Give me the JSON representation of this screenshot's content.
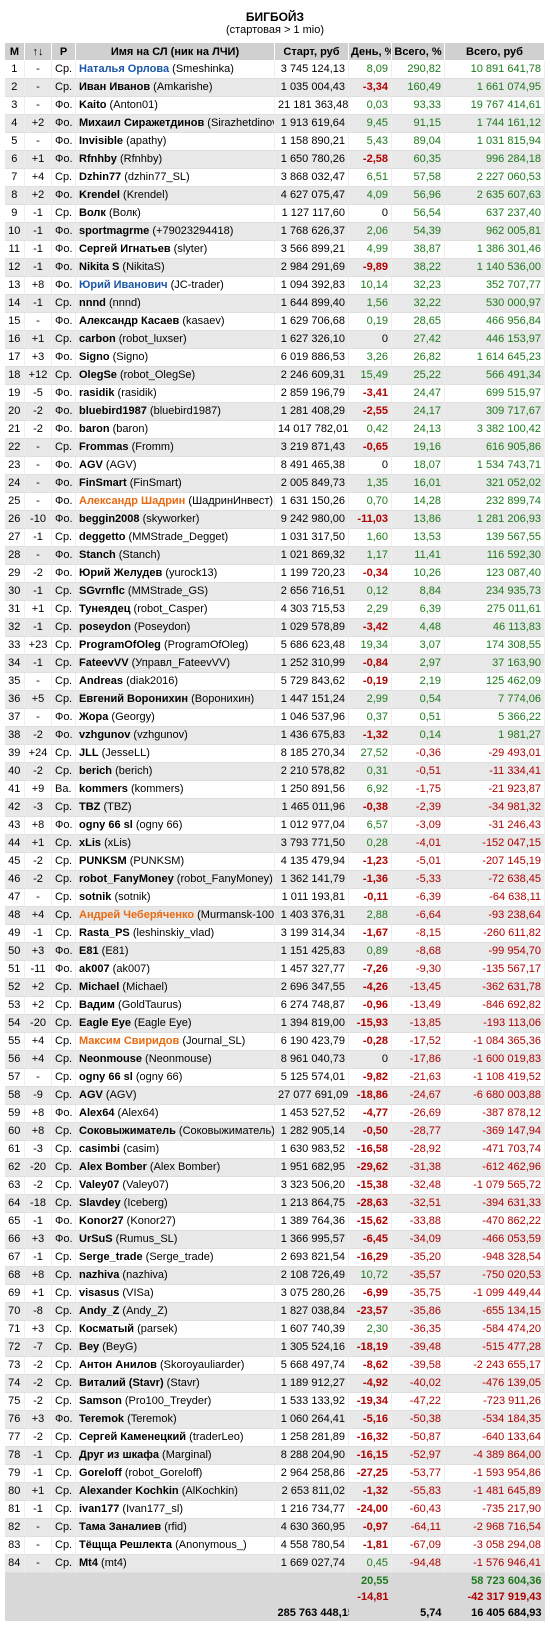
{
  "title": "БИГБОЙЗ",
  "subtitle": "(стартовая > 1 mio)",
  "columns": [
    "М",
    "↑↓",
    "Р",
    "Имя на СЛ (ник на ЛЧИ)",
    "Старт, руб",
    "День, %",
    "Всего, %",
    "Всего, руб"
  ],
  "rows": [
    [
      "1",
      "-",
      "Ср.",
      "Наталья Орлова",
      "Smeshinka",
      "3 745 124,13",
      "8,09",
      "290,82",
      "10 891 641,78"
    ],
    [
      "2",
      "-",
      "Ср.",
      "Иван Иванов",
      "Amkarishe",
      "1 035 004,43",
      "-3,34",
      "160,49",
      "1 661 074,95"
    ],
    [
      "3",
      "-",
      "Фо.",
      "Kaito",
      "Anton01",
      "21 181 363,48",
      "0,03",
      "93,33",
      "19 767 414,61"
    ],
    [
      "4",
      "+2",
      "Фо.",
      "Михаил Сиражетдинов",
      "Sirazhetdinov",
      "1 913 619,64",
      "9,45",
      "91,15",
      "1 744 161,12"
    ],
    [
      "5",
      "-",
      "Фо.",
      "Invisible",
      "apathy",
      "1 158 890,21",
      "5,43",
      "89,04",
      "1 031 815,94"
    ],
    [
      "6",
      "+1",
      "Фо.",
      "Rfnhby",
      "Rfnhby",
      "1 650 780,26",
      "-2,58",
      "60,35",
      "996 284,18"
    ],
    [
      "7",
      "+4",
      "Ср.",
      "Dzhin77",
      "dzhin77_SL",
      "3 868 032,47",
      "6,51",
      "57,58",
      "2 227 060,53"
    ],
    [
      "8",
      "+2",
      "Фо.",
      "Krendel",
      "Krendel",
      "4 627 075,47",
      "4,09",
      "56,96",
      "2 635 607,63"
    ],
    [
      "9",
      "-1",
      "Ср.",
      "Волк",
      "Волк",
      "1 127 117,60",
      "0",
      "56,54",
      "637 237,40"
    ],
    [
      "10",
      "-1",
      "Фо.",
      "sportmagrme",
      "+79023294418",
      "1 768 626,37",
      "2,06",
      "54,39",
      "962 005,81"
    ],
    [
      "11",
      "-1",
      "Фо.",
      "Сергей Игнатьев",
      "slyter",
      "3 566 899,21",
      "4,99",
      "38,87",
      "1 386 301,46"
    ],
    [
      "12",
      "-1",
      "Фо.",
      "Nikita S",
      "NikitaS",
      "2 984 291,69",
      "-9,89",
      "38,22",
      "1 140 536,00"
    ],
    [
      "13",
      "+8",
      "Фо.",
      "Юрий Иванович",
      "JC-trader",
      "1 094 392,83",
      "10,14",
      "32,23",
      "352 707,77"
    ],
    [
      "14",
      "-1",
      "Ср.",
      "nnnd",
      "nnnd",
      "1 644 899,40",
      "1,56",
      "32,22",
      "530 000,97"
    ],
    [
      "15",
      "-",
      "Фо.",
      "Александр Касаев",
      "kasaev",
      "1 629 706,68",
      "0,19",
      "28,65",
      "466 956,84"
    ],
    [
      "16",
      "+1",
      "Ср.",
      "carbon",
      "robot_luxser",
      "1 627 326,10",
      "0",
      "27,42",
      "446 153,97"
    ],
    [
      "17",
      "+3",
      "Фо.",
      "Signo",
      "Signo",
      "6 019 886,53",
      "3,26",
      "26,82",
      "1 614 645,23"
    ],
    [
      "18",
      "+12",
      "Ср.",
      "OlegSe",
      "robot_OlegSe",
      "2 246 609,31",
      "15,49",
      "25,22",
      "566 491,34"
    ],
    [
      "19",
      "-5",
      "Фо.",
      "rasidik",
      "rasidik",
      "2 859 196,79",
      "-3,41",
      "24,47",
      "699 515,97"
    ],
    [
      "20",
      "-2",
      "Фо.",
      "bluebird1987",
      "bluebird1987",
      "1 281 408,29",
      "-2,55",
      "24,17",
      "309 717,67"
    ],
    [
      "21",
      "-2",
      "Фо.",
      "baron",
      "baron",
      "14 017 782,01",
      "0,42",
      "24,13",
      "3 382 100,42"
    ],
    [
      "22",
      "-",
      "Ср.",
      "Frommas",
      "Fromm",
      "3 219 871,43",
      "-0,65",
      "19,16",
      "616 905,86"
    ],
    [
      "23",
      "-",
      "Фо.",
      "AGV",
      "AGV",
      "8 491 465,38",
      "0",
      "18,07",
      "1 534 743,71"
    ],
    [
      "24",
      "-",
      "Фо.",
      "FinSmart",
      "FinSmart",
      "2 005 849,73",
      "1,35",
      "16,01",
      "321 052,02"
    ],
    [
      "25",
      "-",
      "Фо.",
      "Александр Шадрин",
      "ШадринИнвест",
      "1 631 150,26",
      "0,70",
      "14,28",
      "232 899,74"
    ],
    [
      "26",
      "-10",
      "Фо.",
      "beggin2008",
      "skyworker",
      "9 242 980,00",
      "-11,03",
      "13,86",
      "1 281 206,93"
    ],
    [
      "27",
      "-1",
      "Ср.",
      "deggetto",
      "MMStrade_Degget",
      "1 031 317,50",
      "1,60",
      "13,53",
      "139 567,55"
    ],
    [
      "28",
      "-",
      "Фо.",
      "Stanch",
      "Stanch",
      "1 021 869,32",
      "1,17",
      "11,41",
      "116 592,30"
    ],
    [
      "29",
      "-2",
      "Фо.",
      "Юрий Желудев",
      "yurock13",
      "1 199 720,23",
      "-0,34",
      "10,26",
      "123 087,40"
    ],
    [
      "30",
      "-1",
      "Ср.",
      "SGvrnflc",
      "MMStrade_GS",
      "2 656 716,51",
      "0,12",
      "8,84",
      "234 935,73"
    ],
    [
      "31",
      "+1",
      "Ср.",
      "Тунеядец",
      "robot_Casper",
      "4 303 715,53",
      "2,29",
      "6,39",
      "275 011,61"
    ],
    [
      "32",
      "-1",
      "Ср.",
      "poseydon",
      "Poseydon",
      "1 029 578,89",
      "-3,42",
      "4,48",
      "46 113,83"
    ],
    [
      "33",
      "+23",
      "Ср.",
      "ProgramOfOleg",
      "ProgramOfOleg",
      "5 686 623,48",
      "19,34",
      "3,07",
      "174 308,55"
    ],
    [
      "34",
      "-1",
      "Ср.",
      "FateevVV",
      "Управл_FateevVV",
      "1 252 310,99",
      "-0,84",
      "2,97",
      "37 163,90"
    ],
    [
      "35",
      "-",
      "Ср.",
      "Andreas",
      "diak2016",
      "5 729 843,62",
      "-0,19",
      "2,19",
      "125 462,09"
    ],
    [
      "36",
      "+5",
      "Ср.",
      "Евгений Воронихин",
      "Воронихин",
      "1 447 151,24",
      "2,99",
      "0,54",
      "7 774,06"
    ],
    [
      "37",
      "-",
      "Фо.",
      "Жора",
      "Georgy",
      "1 046 537,96",
      "0,37",
      "0,51",
      "5 366,22"
    ],
    [
      "38",
      "-2",
      "Фо.",
      "vzhgunov",
      "vzhgunov",
      "1 436 675,83",
      "-1,32",
      "0,14",
      "1 981,27"
    ],
    [
      "39",
      "+24",
      "Ср.",
      "JLL",
      "JesseLL",
      "8 185 270,34",
      "27,52",
      "-0,36",
      "-29 493,01"
    ],
    [
      "40",
      "-2",
      "Ср.",
      "berich",
      "berich",
      "2 210 578,82",
      "0,31",
      "-0,51",
      "-11 334,41"
    ],
    [
      "41",
      "+9",
      "Ва.",
      "kommers",
      "kommers",
      "1 250 891,56",
      "6,92",
      "-1,75",
      "-21 923,87"
    ],
    [
      "42",
      "-3",
      "Ср.",
      "TBZ",
      "TBZ",
      "1 465 011,96",
      "-0,38",
      "-2,39",
      "-34 981,32"
    ],
    [
      "43",
      "+8",
      "Фо.",
      "ogny 66 sl",
      "ogny 66",
      "1 012 977,04",
      "6,57",
      "-3,09",
      "-31 246,43"
    ],
    [
      "44",
      "+1",
      "Ср.",
      "xLis",
      "xLis",
      "3 793 771,50",
      "0,28",
      "-4,01",
      "-152 047,15"
    ],
    [
      "45",
      "-2",
      "Ср.",
      "PUNKSM",
      "PUNKSM",
      "4 135 479,94",
      "-1,23",
      "-5,01",
      "-207 145,19"
    ],
    [
      "46",
      "-2",
      "Ср.",
      "robot_FanyMoney",
      "robot_FanyMoney",
      "1 362 141,79",
      "-1,36",
      "-5,33",
      "-72 638,45"
    ],
    [
      "47",
      "-",
      "Ср.",
      "sotnik",
      "sotnik",
      "1 011 193,81",
      "-0,11",
      "-6,39",
      "-64 638,11"
    ],
    [
      "48",
      "+4",
      "Ср.",
      "Андрей Чеберя́ченко",
      "Murmansk-100",
      "1 403 376,31",
      "2,88",
      "-6,64",
      "-93 238,64"
    ],
    [
      "49",
      "-1",
      "Ср.",
      "Rasta_PS",
      "leshinskiy_vlad",
      "3 199 314,34",
      "-1,67",
      "-8,15",
      "-260 611,82"
    ],
    [
      "50",
      "+3",
      "Фо.",
      "E81",
      "E81",
      "1 151 425,83",
      "0,89",
      "-8,68",
      "-99 954,70"
    ],
    [
      "51",
      "-11",
      "Фо.",
      "ak007",
      "ak007",
      "1 457 327,77",
      "-7,26",
      "-9,30",
      "-135 567,17"
    ],
    [
      "52",
      "+2",
      "Ср.",
      "Michael",
      "Michael",
      "2 696 347,55",
      "-4,26",
      "-13,45",
      "-362 631,78"
    ],
    [
      "53",
      "+2",
      "Ср.",
      "Вадим",
      "GoldTaurus",
      "6 274 748,87",
      "-0,96",
      "-13,49",
      "-846 692,82"
    ],
    [
      "54",
      "-20",
      "Ср.",
      "Eagle Eye",
      "Eagle Eye",
      "1 394 819,00",
      "-15,93",
      "-13,85",
      "-193 113,06"
    ],
    [
      "55",
      "+4",
      "Ср.",
      "Максим Свиридов",
      "Journal_SL",
      "6 190 423,79",
      "-0,28",
      "-17,52",
      "-1 084 365,36"
    ],
    [
      "56",
      "+4",
      "Ср.",
      "Neonmouse",
      "Neonmouse",
      "8 961 040,73",
      "0",
      "-17,86",
      "-1 600 019,83"
    ],
    [
      "57",
      "-",
      "Ср.",
      "ogny 66 sl",
      "ogny 66",
      "5 125 574,01",
      "-9,82",
      "-21,63",
      "-1 108 419,52"
    ],
    [
      "58",
      "-9",
      "Ср.",
      "AGV",
      "AGV",
      "27 077 691,09",
      "-18,86",
      "-24,67",
      "-6 680 003,88"
    ],
    [
      "59",
      "+8",
      "Фо.",
      "Alex64",
      "Alex64",
      "1 453 527,52",
      "-4,77",
      "-26,69",
      "-387 878,12"
    ],
    [
      "60",
      "+8",
      "Ср.",
      "Соковыжиматель",
      "Соковыжиматель",
      "1 282 905,14",
      "-0,50",
      "-28,77",
      "-369 147,94"
    ],
    [
      "61",
      "-3",
      "Ср.",
      "casimbi",
      "casim",
      "1 630 983,52",
      "-16,58",
      "-28,92",
      "-471 703,74"
    ],
    [
      "62",
      "-20",
      "Ср.",
      "Alex Bomber",
      "Alex Bomber",
      "1 951 682,95",
      "-29,62",
      "-31,38",
      "-612 462,96"
    ],
    [
      "63",
      "-2",
      "Ср.",
      "Valey07",
      "Valey07",
      "3 323 506,20",
      "-15,38",
      "-32,48",
      "-1 079 565,72"
    ],
    [
      "64",
      "-18",
      "Ср.",
      "Slavdey",
      "Iceberg",
      "1 213 864,75",
      "-28,63",
      "-32,51",
      "-394 631,33"
    ],
    [
      "65",
      "-1",
      "Фо.",
      "Konor27",
      "Konor27",
      "1 389 764,36",
      "-15,62",
      "-33,88",
      "-470 862,22"
    ],
    [
      "66",
      "+3",
      "Фо.",
      "UrSuS",
      "Rumus_SL",
      "1 366 995,57",
      "-6,45",
      "-34,09",
      "-466 053,59"
    ],
    [
      "67",
      "-1",
      "Ср.",
      "Serge_trade",
      "Serge_trade",
      "2 693 821,54",
      "-16,29",
      "-35,20",
      "-948 328,54"
    ],
    [
      "68",
      "+8",
      "Ср.",
      "nazhiva",
      "nazhiva",
      "2 108 726,49",
      "10,72",
      "-35,57",
      "-750 020,53"
    ],
    [
      "69",
      "+1",
      "Ср.",
      "visasus",
      "VISa",
      "3 075 280,26",
      "-6,99",
      "-35,75",
      "-1 099 449,44"
    ],
    [
      "70",
      "-8",
      "Ср.",
      "Andy_Z",
      "Andy_Z",
      "1 827 038,84",
      "-23,57",
      "-35,86",
      "-655 134,15"
    ],
    [
      "71",
      "+3",
      "Ср.",
      "Косматый",
      "parsek",
      "1 607 740,39",
      "2,30",
      "-36,35",
      "-584 474,20"
    ],
    [
      "72",
      "-7",
      "Ср.",
      "Bey",
      "BeyG",
      "1 305 524,16",
      "-18,19",
      "-39,48",
      "-515 477,28"
    ],
    [
      "73",
      "-2",
      "Ср.",
      "Антон Анилов",
      "Skoroyauliarder",
      "5 668 497,74",
      "-8,62",
      "-39,58",
      "-2 243 655,17"
    ],
    [
      "74",
      "-2",
      "Ср.",
      "Виталий (Stavr)",
      "Stavr",
      "1 189 912,27",
      "-4,92",
      "-40,02",
      "-476 139,05"
    ],
    [
      "75",
      "-2",
      "Ср.",
      "Samson",
      "Pro100_Treyder",
      "1 533 133,92",
      "-19,34",
      "-47,22",
      "-723 911,26"
    ],
    [
      "76",
      "+3",
      "Фо.",
      "Teremok",
      "Teremok",
      "1 060 264,41",
      "-5,16",
      "-50,38",
      "-534 184,35"
    ],
    [
      "77",
      "-2",
      "Ср.",
      "Сергей Каменецкий",
      "traderLeo",
      "1 258 281,89",
      "-16,32",
      "-50,87",
      "-640 133,64"
    ],
    [
      "78",
      "-1",
      "Ср.",
      "Друг из шкафа",
      "Marginal",
      "8 288 204,90",
      "-16,15",
      "-52,97",
      "-4 389 864,00"
    ],
    [
      "79",
      "-1",
      "Ср.",
      "Goreloff",
      "robot_Goreloff",
      "2 964 258,86",
      "-27,25",
      "-53,77",
      "-1 593 954,86"
    ],
    [
      "80",
      "+1",
      "Ср.",
      "Alexander Kochkin",
      "AlKochkin",
      "2 653 811,02",
      "-1,32",
      "-55,83",
      "-1 481 645,89"
    ],
    [
      "81",
      "-1",
      "Ср.",
      "ivan177",
      "Ivan177_sl",
      "1 216 734,77",
      "-24,00",
      "-60,43",
      "-735 217,90"
    ],
    [
      "82",
      "-",
      "Ср.",
      "Тама Заналиев",
      "rfid",
      "4 630 360,95",
      "-0,97",
      "-64,11",
      "-2 968 716,54"
    ],
    [
      "83",
      "-",
      "Ср.",
      "Тёщща Решлекта",
      "Anonymous_",
      "4 558 780,54",
      "-1,81",
      "-67,09",
      "-3 058 294,08"
    ],
    [
      "84",
      "-",
      "Ср.",
      "Mt4",
      "mt4",
      "1 669 027,74",
      "0,45",
      "-94,48",
      "-1 576 946,41"
    ]
  ],
  "blue_names": [
    "1",
    "13"
  ],
  "orange_names": [
    "25",
    "48",
    "55"
  ],
  "totals": {
    "day_pos": "20,55",
    "total_rub_pos": "58 723 604,36",
    "day_neg": "-14,81",
    "total_rub_neg": "-42 317 919,43",
    "start_sum": "285 763 448,15",
    "total_pct": "5,74",
    "total_rub": "16 405 684,93"
  },
  "colors": {
    "header_bg": "#d0d0d0",
    "row_alt": "#e8e8e8",
    "red": "#b00000",
    "green": "#1c7a1c",
    "blue": "#1a56a6",
    "orange": "#e86a12"
  }
}
